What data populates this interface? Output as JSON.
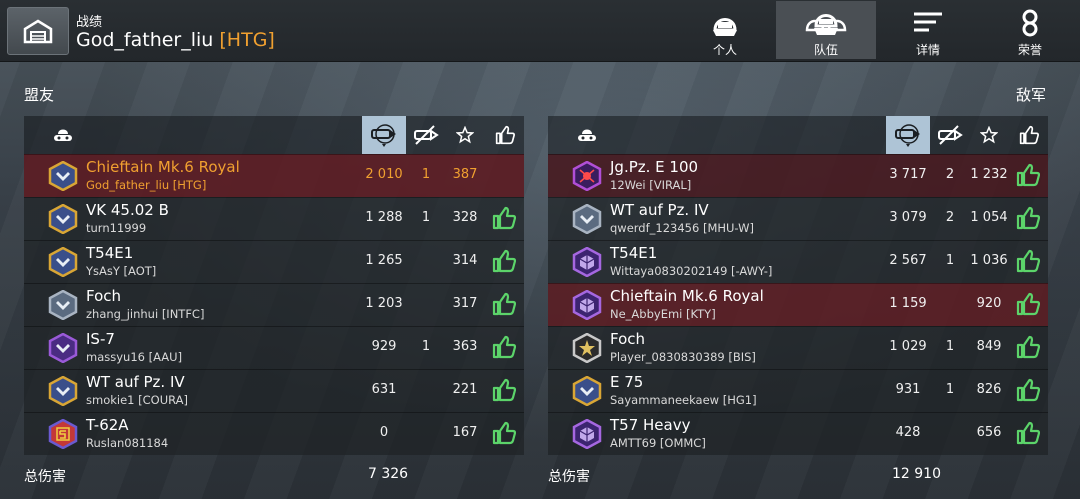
{
  "header": {
    "label": "战绩",
    "player_name": "God_father_liu",
    "player_clan": "[HTG]",
    "tabs": [
      {
        "label": "个人",
        "icon": "personal-helmet-icon"
      },
      {
        "label": "队伍",
        "icon": "team-helmets-icon",
        "active": true
      },
      {
        "label": "详情",
        "icon": "details-lines-icon"
      },
      {
        "label": "荣誉",
        "icon": "medal-icon"
      }
    ]
  },
  "allies": {
    "title": "盟友",
    "total_label": "总伤害",
    "total_damage": "7 326",
    "rows": [
      {
        "tank": "Chieftain Mk.6 Royal",
        "player": "God_father_liu [HTG]",
        "damage": "2 010",
        "kills": "1",
        "xp": "387",
        "liked": false,
        "self": true,
        "badge": "gold"
      },
      {
        "tank": "VK 45.02 B",
        "player": "turn11999",
        "damage": "1 288",
        "kills": "1",
        "xp": "328",
        "liked": true,
        "badge": "gold"
      },
      {
        "tank": "T54E1",
        "player": "YsAsY [AOT]",
        "damage": "1 265",
        "kills": "",
        "xp": "314",
        "liked": true,
        "badge": "gold"
      },
      {
        "tank": "Foch",
        "player": "zhang_jinhui [INTFC]",
        "damage": "1 203",
        "kills": "",
        "xp": "317",
        "liked": true,
        "badge": "silver"
      },
      {
        "tank": "IS-7",
        "player": "massyu16 [AAU]",
        "damage": "929",
        "kills": "1",
        "xp": "363",
        "liked": true,
        "badge": "purple"
      },
      {
        "tank": "WT auf Pz. IV",
        "player": "smokie1 [COURA]",
        "damage": "631",
        "kills": "",
        "xp": "221",
        "liked": true,
        "badge": "gold"
      },
      {
        "tank": "T-62A",
        "player": "Ruslan081184",
        "damage": "0",
        "kills": "",
        "xp": "167",
        "liked": true,
        "badge": "five"
      }
    ]
  },
  "enemies": {
    "title": "敌军",
    "total_label": "总伤害",
    "total_damage": "12 910",
    "rows": [
      {
        "tank": "Jg.Pz. E 100",
        "player": "12Wei [VIRAL]",
        "damage": "3 717",
        "kills": "2",
        "xp": "1 232",
        "liked": true,
        "badge": "spider",
        "tone": "dark-red"
      },
      {
        "tank": "WT auf Pz. IV",
        "player": "qwerdf_123456 [MHU-W]",
        "damage": "3 079",
        "kills": "2",
        "xp": "1 054",
        "liked": true,
        "badge": "silver",
        "tone": "plain"
      },
      {
        "tank": "T54E1",
        "player": "Wittaya0830202149 [-AWY-]",
        "damage": "2 567",
        "kills": "1",
        "xp": "1 036",
        "liked": true,
        "badge": "purple-cube",
        "tone": "plain"
      },
      {
        "tank": "Chieftain Mk.6 Royal",
        "player": "Ne_AbbyEmi [KTY]",
        "damage": "1 159",
        "kills": "",
        "xp": "920",
        "liked": true,
        "badge": "purple-cube",
        "tone": "red"
      },
      {
        "tank": "Foch",
        "player": "Player_0830830389 [BIS]",
        "damage": "1 029",
        "kills": "1",
        "xp": "849",
        "liked": true,
        "badge": "star",
        "tone": "plain"
      },
      {
        "tank": "E 75",
        "player": "Sayammaneekaew [HG1]",
        "damage": "931",
        "kills": "1",
        "xp": "826",
        "liked": true,
        "badge": "gold",
        "tone": "plain"
      },
      {
        "tank": "T57 Heavy",
        "player": "AMTT69 [OMMC]",
        "damage": "428",
        "kills": "",
        "xp": "656",
        "liked": true,
        "badge": "purple-cube",
        "tone": "plain"
      }
    ]
  },
  "colors": {
    "accent_orange": "#f0a030",
    "like_green": "#5cd46a",
    "sorted_col": "#aec4d6"
  }
}
